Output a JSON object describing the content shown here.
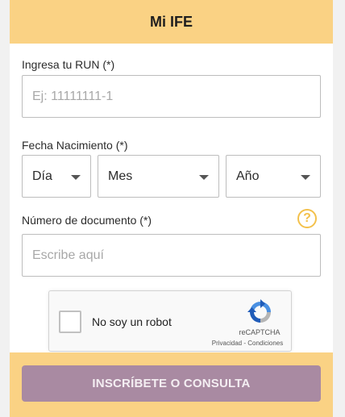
{
  "header": {
    "title": "Mi IFE"
  },
  "run": {
    "label": "Ingresa tu RUN (*)",
    "placeholder": "Ej: 11111111-1"
  },
  "birthdate": {
    "label": "Fecha Nacimiento (*)",
    "day": "Día",
    "month": "Mes",
    "year": "Año"
  },
  "document": {
    "label": "Número de documento (*)",
    "placeholder": "Escribe aquí",
    "help_icon": "question-circle-icon"
  },
  "captcha": {
    "label": "No soy un robot",
    "brand": "reCAPTCHA",
    "links": "Privacidad - Condiciones",
    "icon": "recaptcha-logo-icon"
  },
  "submit": {
    "label": "INSCRÍBETE O CONSULTA"
  },
  "colors": {
    "header_bg": "#fad284",
    "button_bg": "#a98aa2",
    "help_icon": "#f3c14c"
  }
}
